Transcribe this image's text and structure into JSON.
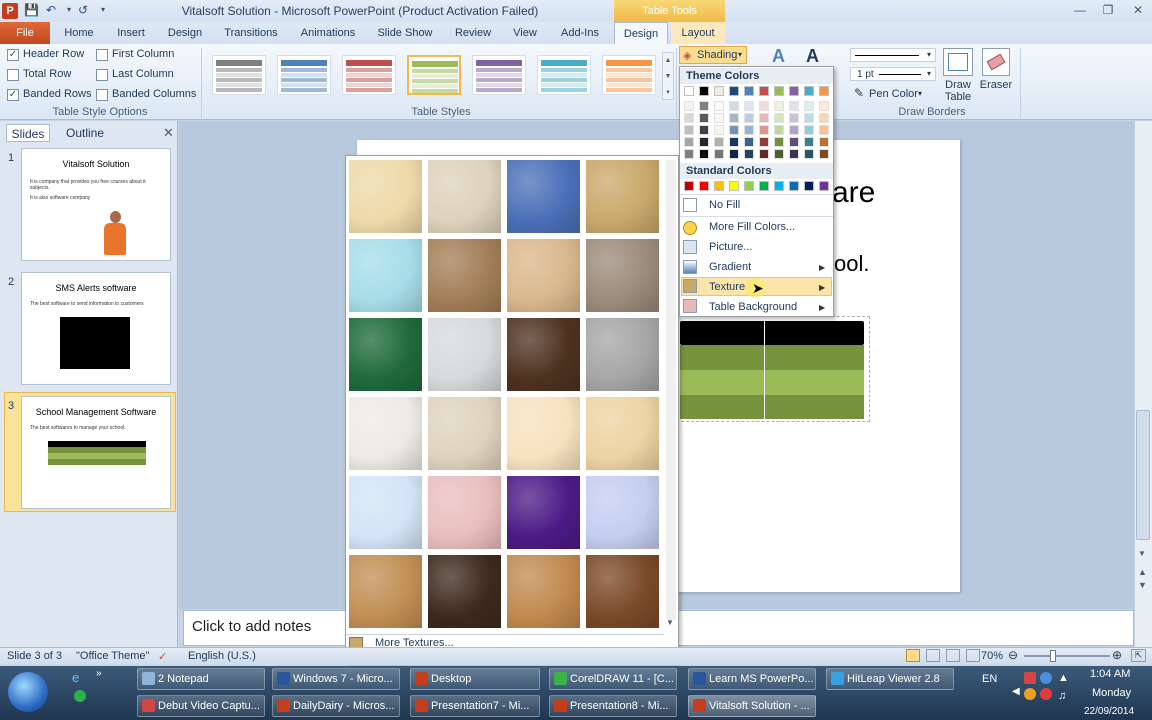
{
  "window": {
    "title": "Vitalsoft Solution  -  Microsoft PowerPoint (Product Activation Failed)",
    "app_icon": "P",
    "contextual_tab_group": "Table Tools"
  },
  "tabs": [
    "File",
    "Home",
    "Insert",
    "Design",
    "Transitions",
    "Animations",
    "Slide Show",
    "Review",
    "View",
    "Add-Ins",
    "Design",
    "Layout"
  ],
  "ribbon": {
    "options": {
      "header_row": "Header Row",
      "first_column": "First Column",
      "total_row": "Total Row",
      "last_column": "Last Column",
      "banded_rows": "Banded Rows",
      "banded_columns": "Banded Columns",
      "group_label": "Table Style Options"
    },
    "styles_group_label": "Table Styles",
    "shading_label": "Shading",
    "pen_weight": "1 pt",
    "pen_color_label": "Pen Color",
    "draw_table_label_1": "Draw",
    "draw_table_label_2": "Table",
    "eraser_label": "Eraser",
    "draw_borders_label": "Draw Borders",
    "style_colors": [
      "#7f7f7f",
      "#4f81bd",
      "#c0504d",
      "#9bbb59",
      "#8064a2",
      "#4bacc6",
      "#f79646"
    ]
  },
  "panel": {
    "tab_slides": "Slides",
    "tab_outline": "Outline",
    "slides": [
      {
        "num": "1",
        "title": "Vitalsoft Solution",
        "bullets": [
          "It is company that provides you free courses about it subjects.",
          "It is also software company"
        ]
      },
      {
        "num": "2",
        "title": "SMS Alerts software",
        "bullets": [
          "The best software to send information to customers"
        ]
      },
      {
        "num": "3",
        "title": "School Management Software",
        "bullets": [
          "The best softwares to manage your school."
        ]
      }
    ]
  },
  "slide": {
    "title_fragment": "are",
    "body_fragment": "ool."
  },
  "notes_placeholder": "Click to add notes",
  "texture_gallery": {
    "more_textures": "More Textures...",
    "textures": [
      "#eed9a8",
      "#ddd2bb",
      "#4b70b8",
      "#c9a86a",
      "#a5dde9",
      "#a37e57",
      "#d9b78c",
      "#9b8b7a",
      "#1e6b3b",
      "#d7dadb",
      "#4e3220",
      "#a6a6a6",
      "#ecebe3",
      "#ded3bd",
      "#f6e2bf",
      "#edd3a3",
      "#d3e4f6",
      "#eabdbe",
      "#4c1b86",
      "#c5cdf0",
      "#c18f55",
      "#3e2a1e",
      "#c08a4f",
      "#7a4a28"
    ]
  },
  "shading_menu": {
    "theme_colors_label": "Theme Colors",
    "standard_colors_label": "Standard Colors",
    "theme_top": [
      "#ffffff",
      "#000000",
      "#eeece1",
      "#1f497d",
      "#4f81bd",
      "#c0504d",
      "#9bbb59",
      "#8064a2",
      "#4bacc6",
      "#f79646"
    ],
    "standard": [
      "#c00000",
      "#ff0000",
      "#ffc000",
      "#ffff00",
      "#92d050",
      "#00b050",
      "#00b0f0",
      "#0070c0",
      "#002060",
      "#7030a0"
    ],
    "no_fill": "No Fill",
    "more_fill_colors": "More Fill Colors...",
    "picture": "Picture...",
    "gradient": "Gradient",
    "texture": "Texture",
    "table_background": "Table Background"
  },
  "status": {
    "slide": "Slide 3 of 3",
    "theme": "\"Office Theme\"",
    "language": "English (U.S.)",
    "zoom": "70%"
  },
  "taskbar": {
    "row1": [
      "2 Notepad",
      "Windows 7 - Micro...",
      "Desktop",
      "CorelDRAW 11 - [C...",
      "Learn MS PowerPo...",
      "HitLeap Viewer 2.8"
    ],
    "row2": [
      "Debut Video Captu...",
      "DailyDairy - Micros...",
      "Presentation7 - Mi...",
      "Presentation8 - Mi...",
      "Vitalsoft Solution - ..."
    ],
    "lang": "EN",
    "time": "1:04 AM",
    "day": "Monday",
    "date": "22/09/2014"
  }
}
